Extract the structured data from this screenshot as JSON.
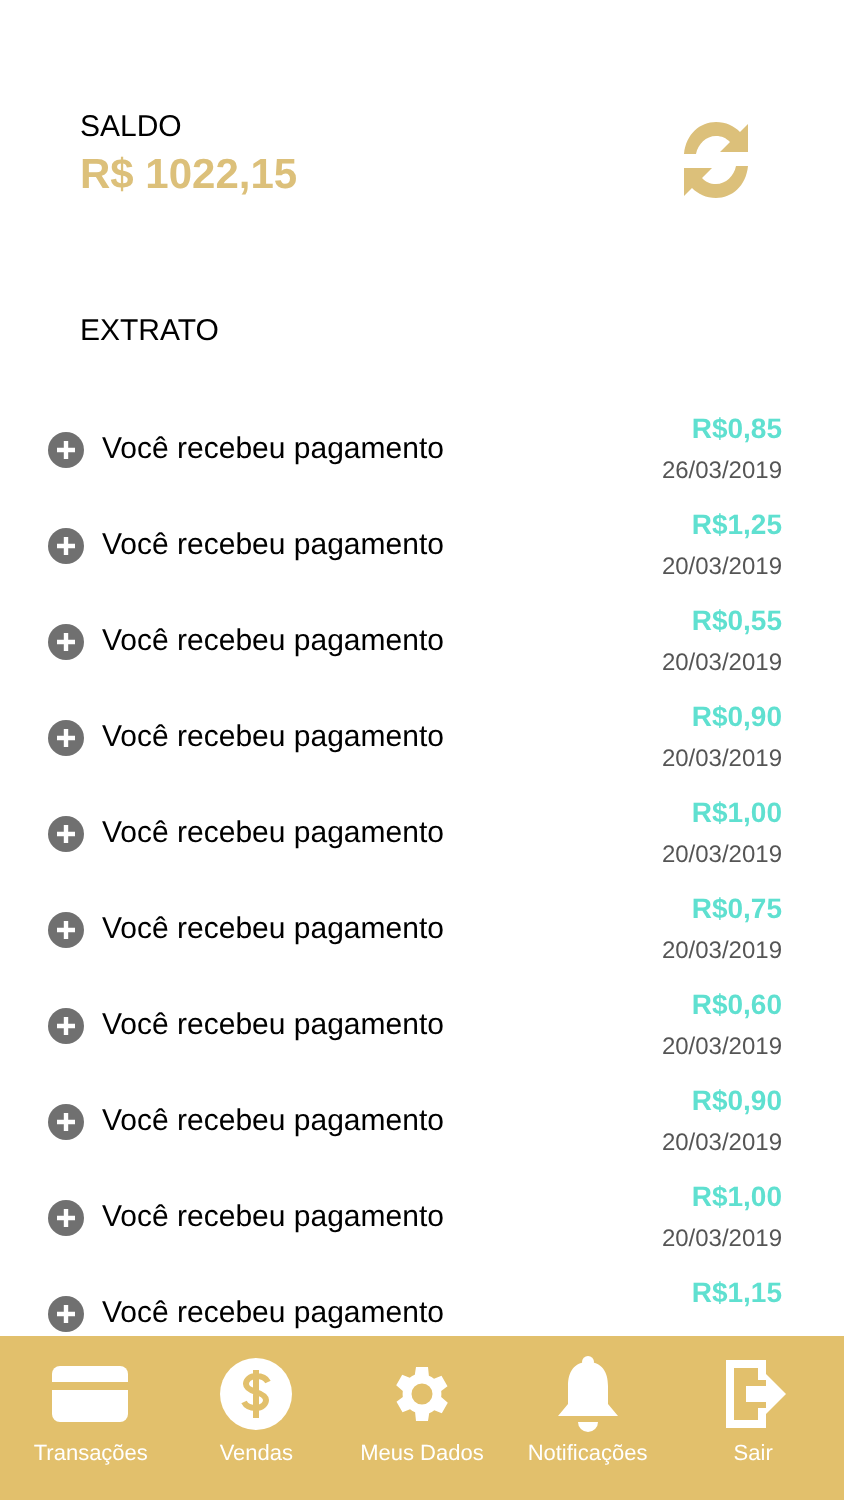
{
  "balance": {
    "label": "SALDO",
    "value": "R$ 1022,15"
  },
  "statement": {
    "title": "EXTRATO",
    "items": [
      {
        "description": "Você recebeu pagamento",
        "amount": "R$0,85",
        "date": "26/03/2019"
      },
      {
        "description": "Você recebeu pagamento",
        "amount": "R$1,25",
        "date": "20/03/2019"
      },
      {
        "description": "Você recebeu pagamento",
        "amount": "R$0,55",
        "date": "20/03/2019"
      },
      {
        "description": "Você recebeu pagamento",
        "amount": "R$0,90",
        "date": "20/03/2019"
      },
      {
        "description": "Você recebeu pagamento",
        "amount": "R$1,00",
        "date": "20/03/2019"
      },
      {
        "description": "Você recebeu pagamento",
        "amount": "R$0,75",
        "date": "20/03/2019"
      },
      {
        "description": "Você recebeu pagamento",
        "amount": "R$0,60",
        "date": "20/03/2019"
      },
      {
        "description": "Você recebeu pagamento",
        "amount": "R$0,90",
        "date": "20/03/2019"
      },
      {
        "description": "Você recebeu pagamento",
        "amount": "R$1,00",
        "date": "20/03/2019"
      },
      {
        "description": "Você recebeu pagamento",
        "amount": "R$1,15"
      }
    ]
  },
  "tab_bar": [
    {
      "kind": "card",
      "label": "Transações"
    },
    {
      "kind": "dollar",
      "label": "Vendas"
    },
    {
      "kind": "gear",
      "label": "Meus Dados"
    },
    {
      "kind": "bell",
      "label": "Notificações"
    },
    {
      "kind": "exit",
      "label": "Sair"
    }
  ]
}
